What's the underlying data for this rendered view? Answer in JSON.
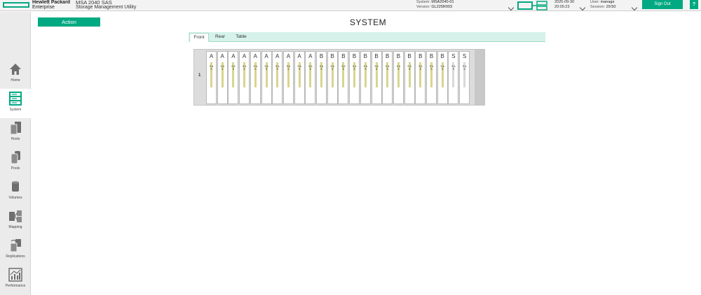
{
  "header": {
    "brand_line1": "Hewlett Packard",
    "brand_line2": "Enterprise",
    "product_line1": "MSA 2040 SAS",
    "product_line2": "Storage Management Utility",
    "system_label": "System:",
    "system_value": "MSA2040-01",
    "version_label": "Version:",
    "version_value": "GL225R003",
    "date": "2025-09-30",
    "time": "20:05:23",
    "user_label": "User:",
    "user_value": "manage",
    "session_label": "Session:",
    "session_value": "29:50",
    "sign_out": "Sign Out",
    "help": "?"
  },
  "sidebar": {
    "items": [
      {
        "label": "Home",
        "icon": "home-icon"
      },
      {
        "label": "System",
        "icon": "system-icon",
        "active": true
      },
      {
        "label": "Hosts",
        "icon": "hosts-icon"
      },
      {
        "label": "Pools",
        "icon": "pools-icon"
      },
      {
        "label": "Volumes",
        "icon": "volumes-icon"
      },
      {
        "label": "Mapping",
        "icon": "mapping-icon"
      },
      {
        "label": "Replications",
        "icon": "replications-icon"
      },
      {
        "label": "Performance",
        "icon": "performance-icon"
      }
    ]
  },
  "main": {
    "action_label": "Action",
    "title": "SYSTEM",
    "tabs": [
      {
        "label": "Front",
        "active": true
      },
      {
        "label": "Rear"
      },
      {
        "label": "Table"
      }
    ],
    "enclosure": {
      "row_label": "1",
      "drives": [
        "A",
        "A",
        "A",
        "A",
        "A",
        "A",
        "A",
        "A",
        "A",
        "A",
        "B",
        "B",
        "B",
        "B",
        "B",
        "B",
        "B",
        "B",
        "B",
        "B",
        "B",
        "B",
        "S",
        "S"
      ],
      "drive_type": "SAS"
    }
  },
  "colors": {
    "accent": "#01a982",
    "tab_bg": "#d6f2ea",
    "drive_led": "#d8d58e",
    "spare_led": "#d9d9d9"
  }
}
